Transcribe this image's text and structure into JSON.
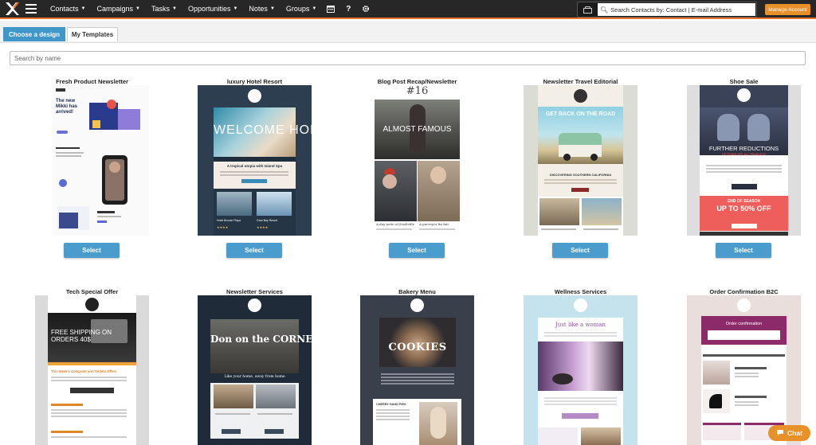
{
  "nav": {
    "items": [
      "Contacts",
      "Campaigns",
      "Tasks",
      "Opportunities",
      "Notes",
      "Groups"
    ],
    "search_placeholder": "Search Contacts by: Contact | E-mail Address",
    "manage_account": "Manage Account"
  },
  "tabs": {
    "choose": "Choose a design",
    "my_templates": "My Templates"
  },
  "search_by_name": "Search by name",
  "select_label": "Select",
  "chat_label": "Chat",
  "templates": [
    {
      "title": "Fresh Product Newsletter",
      "headline": "The new Mikki has arrived!"
    },
    {
      "title": "luxury Hotel Resort",
      "headline": "WELCOME HOME",
      "sub": "A tropical utopia with Island Spa",
      "card_a": "Hotel Bronze Playa",
      "card_b": "Gran Bay Resort"
    },
    {
      "title": "Blog Post Recap/Newsletter",
      "number": "#16",
      "headline": "ALMOST FAMOUS",
      "cap_a": "A day taste of Nashville",
      "cap_b": "A purveyor fin fair"
    },
    {
      "title": "Newsletter Travel Editorial",
      "headline": "GET BACK ON THE ROAD",
      "sub": "DISCOVERING SOUTHERN CALIFORNIA"
    },
    {
      "title": "Shoe Sale",
      "headline": "FURTHER REDUCTIONS",
      "sub": "UP TO 80% OFF ALL PRODUCTS",
      "promo_a": "END OF SEASON",
      "promo_b": "UP TO 50% OFF"
    },
    {
      "title": "Tech Special Offer",
      "headline": "FREE SHIPPING ON ORDERS 40$",
      "sub": "This Week's Computer and Tablets Offers"
    },
    {
      "title": "Newsletter Services",
      "headline": "Don on the CORNER",
      "sub": "Like your home, away from home"
    },
    {
      "title": "Bakery Menu",
      "headline": "COOKIES",
      "sub": "CHERRY HAND PIES"
    },
    {
      "title": "Wellness Services",
      "headline": "Just like a woman"
    },
    {
      "title": "Order Confirmation B2C",
      "headline": "Order confirmation"
    }
  ],
  "colors": {
    "accent": "#3f96c9",
    "orange": "#e8912a",
    "nav_bg": "#272727"
  }
}
